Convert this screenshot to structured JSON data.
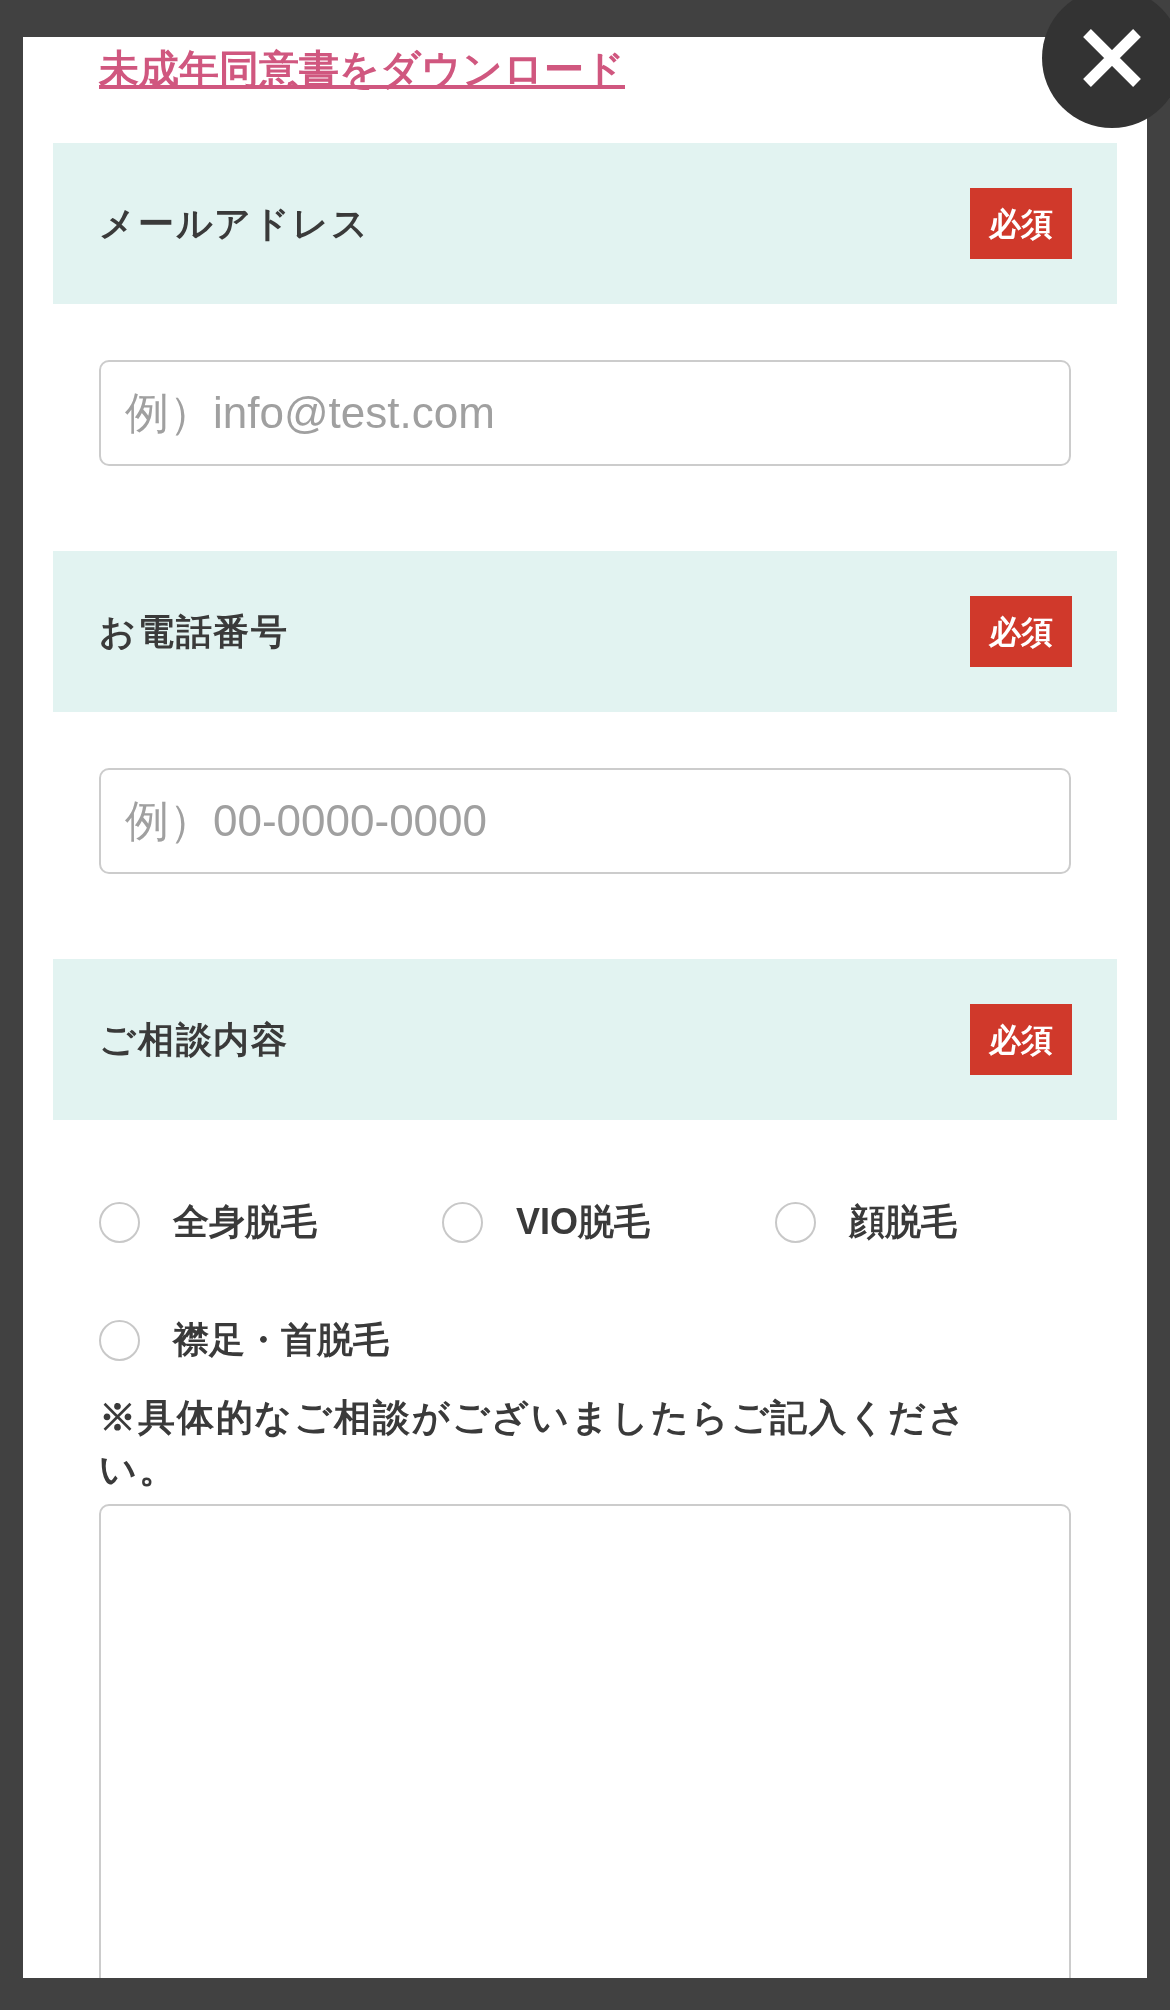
{
  "consent_link": "未成年同意書をダウンロード",
  "fields": [
    {
      "kind": "input",
      "label": "メールアドレス",
      "badge": "必須",
      "placeholder": "例）info@test.com"
    },
    {
      "kind": "input",
      "label": "お電話番号",
      "badge": "必須",
      "placeholder": "例）00-0000-0000"
    },
    {
      "kind": "choices",
      "label": "ご相談内容",
      "badge": "必須",
      "options": [
        {
          "label": "全身脱毛",
          "selected": false
        },
        {
          "label": "VIO脱毛",
          "selected": false
        },
        {
          "label": "顔脱毛",
          "selected": false
        },
        {
          "label": "襟足・首脱毛",
          "selected": false
        }
      ],
      "note": "※具体的なご相談がございましたらご記入ください。"
    }
  ]
}
